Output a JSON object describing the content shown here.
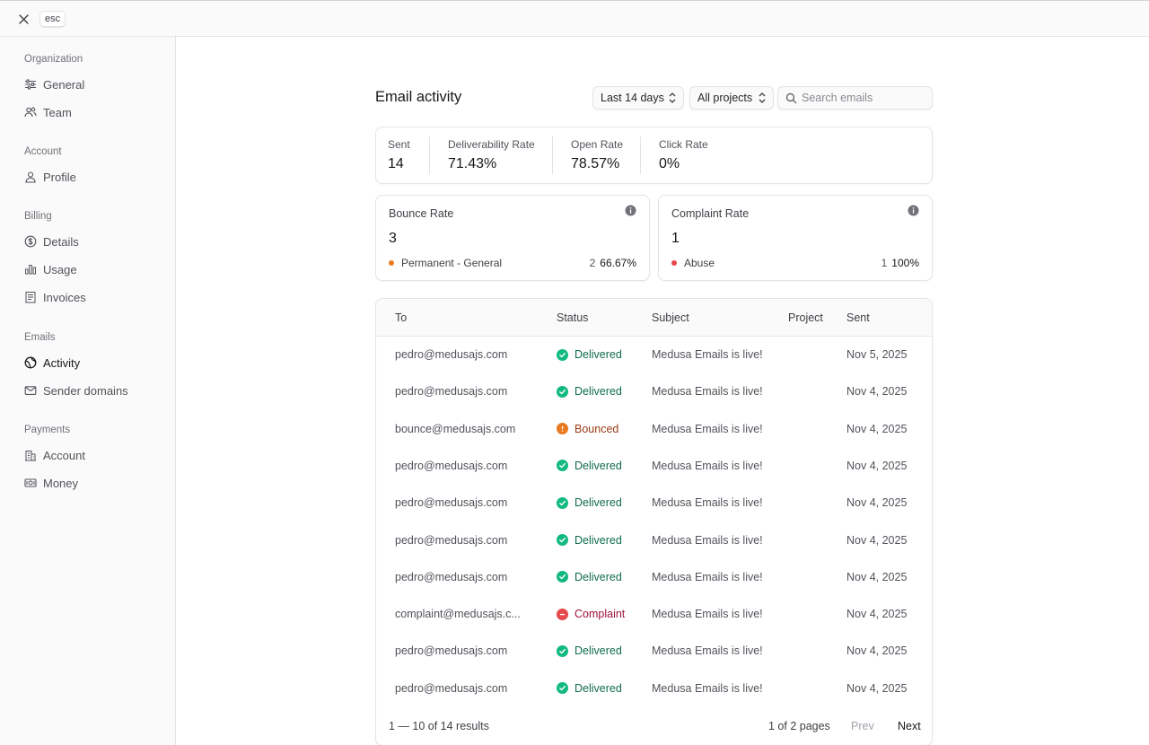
{
  "topbar": {
    "esc_label": "esc"
  },
  "sidebar": {
    "groups": [
      {
        "title": "Organization",
        "items": [
          {
            "label": "General",
            "icon": "sliders-icon"
          },
          {
            "label": "Team",
            "icon": "users-icon"
          }
        ]
      },
      {
        "title": "Account",
        "items": [
          {
            "label": "Profile",
            "icon": "user-icon"
          }
        ]
      },
      {
        "title": "Billing",
        "items": [
          {
            "label": "Details",
            "icon": "dollar-circle-icon"
          },
          {
            "label": "Usage",
            "icon": "bar-chart-icon"
          },
          {
            "label": "Invoices",
            "icon": "receipt-icon"
          }
        ]
      },
      {
        "title": "Emails",
        "items": [
          {
            "label": "Activity",
            "icon": "globe-icon",
            "active": true
          },
          {
            "label": "Sender domains",
            "icon": "mail-icon"
          }
        ]
      },
      {
        "title": "Payments",
        "items": [
          {
            "label": "Account",
            "icon": "building-icon"
          },
          {
            "label": "Money",
            "icon": "money-icon"
          }
        ]
      }
    ]
  },
  "header": {
    "title": "Email activity",
    "range_select": "Last 14 days",
    "project_select": "All projects",
    "search_placeholder": "Search emails"
  },
  "stats": [
    {
      "label": "Sent",
      "value": "14"
    },
    {
      "label": "Deliverability Rate",
      "value": "71.43%"
    },
    {
      "label": "Open Rate",
      "value": "78.57%"
    },
    {
      "label": "Click Rate",
      "value": "0%"
    }
  ],
  "bounce": {
    "title": "Bounce Rate",
    "value": "3",
    "row": {
      "name": "Permanent - General",
      "count": "2",
      "pct": "66.67%",
      "color": "#ea7a1f"
    }
  },
  "complaint": {
    "title": "Complaint Rate",
    "value": "1",
    "row": {
      "name": "Abuse",
      "count": "1",
      "pct": "100%",
      "color": "#e5484d"
    }
  },
  "table": {
    "headers": [
      "To",
      "Status",
      "Subject",
      "Project",
      "Sent"
    ],
    "rows": [
      {
        "to": "pedro@medusajs.com",
        "status": "Delivered",
        "subject": "Medusa Emails is live!",
        "project": "",
        "sent": "Nov 5, 2025"
      },
      {
        "to": "pedro@medusajs.com",
        "status": "Delivered",
        "subject": "Medusa Emails is live!",
        "project": "",
        "sent": "Nov 4, 2025"
      },
      {
        "to": "bounce@medusajs.com",
        "status": "Bounced",
        "subject": "Medusa Emails is live!",
        "project": "",
        "sent": "Nov 4, 2025"
      },
      {
        "to": "pedro@medusajs.com",
        "status": "Delivered",
        "subject": "Medusa Emails is live!",
        "project": "",
        "sent": "Nov 4, 2025"
      },
      {
        "to": "pedro@medusajs.com",
        "status": "Delivered",
        "subject": "Medusa Emails is live!",
        "project": "",
        "sent": "Nov 4, 2025"
      },
      {
        "to": "pedro@medusajs.com",
        "status": "Delivered",
        "subject": "Medusa Emails is live!",
        "project": "",
        "sent": "Nov 4, 2025"
      },
      {
        "to": "pedro@medusajs.com",
        "status": "Delivered",
        "subject": "Medusa Emails is live!",
        "project": "",
        "sent": "Nov 4, 2025"
      },
      {
        "to": "complaint@medusajs.c...",
        "status": "Complaint",
        "subject": "Medusa Emails is live!",
        "project": "",
        "sent": "Nov 4, 2025"
      },
      {
        "to": "pedro@medusajs.com",
        "status": "Delivered",
        "subject": "Medusa Emails is live!",
        "project": "",
        "sent": "Nov 4, 2025"
      },
      {
        "to": "pedro@medusajs.com",
        "status": "Delivered",
        "subject": "Medusa Emails is live!",
        "project": "",
        "sent": "Nov 4, 2025"
      }
    ],
    "status_colors": {
      "Delivered": {
        "icon": "#12b981",
        "text": "#0f6b4f"
      },
      "Bounced": {
        "icon": "#ea7a1f",
        "text": "#9a3b12"
      },
      "Complaint": {
        "icon": "#e5484d",
        "text": "#9f1239"
      }
    }
  },
  "pagination": {
    "results": "1 — 10 of 14 results",
    "pages": "1 of 2 pages",
    "prev": "Prev",
    "next": "Next"
  }
}
